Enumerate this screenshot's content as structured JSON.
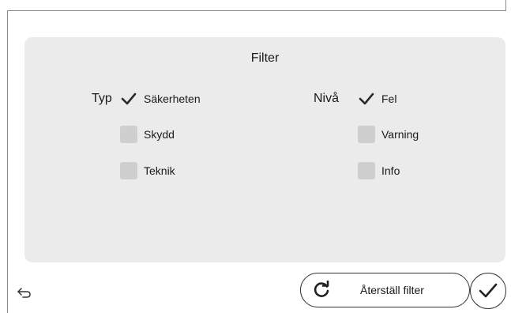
{
  "panel": {
    "title": "Filter"
  },
  "typ": {
    "label": "Typ",
    "options": [
      {
        "label": "Säkerheten",
        "checked": true
      },
      {
        "label": "Skydd",
        "checked": false
      },
      {
        "label": "Teknik",
        "checked": false
      }
    ]
  },
  "niva": {
    "label": "Nivå",
    "options": [
      {
        "label": "Fel",
        "checked": true
      },
      {
        "label": "Varning",
        "checked": false
      },
      {
        "label": "Info",
        "checked": false
      }
    ]
  },
  "footer": {
    "back_icon": "back-arrow-icon",
    "reset_label": "Återställ filter",
    "reset_icon": "refresh-icon",
    "confirm_icon": "checkmark-icon"
  },
  "colors": {
    "panel_bg": "#ebebeb",
    "unchecked_box": "#cfcfcf",
    "check": "#2a2a2a"
  }
}
